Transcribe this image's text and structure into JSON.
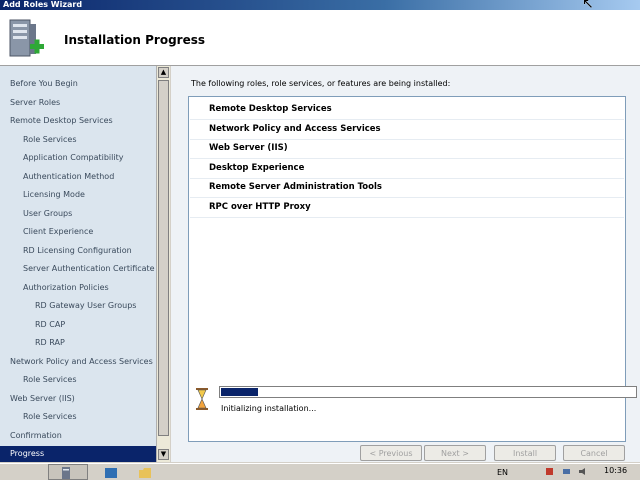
{
  "window": {
    "title": "Add Roles Wizard"
  },
  "header": {
    "title": "Installation Progress",
    "icon": "server-add-icon"
  },
  "nav": {
    "items": [
      {
        "label": "Before You Begin",
        "level": 0
      },
      {
        "label": "Server Roles",
        "level": 0
      },
      {
        "label": "Remote Desktop Services",
        "level": 0
      },
      {
        "label": "Role Services",
        "level": 1
      },
      {
        "label": "Application Compatibility",
        "level": 1
      },
      {
        "label": "Authentication Method",
        "level": 1
      },
      {
        "label": "Licensing Mode",
        "level": 1
      },
      {
        "label": "User Groups",
        "level": 1
      },
      {
        "label": "Client Experience",
        "level": 1
      },
      {
        "label": "RD Licensing Configuration",
        "level": 1
      },
      {
        "label": "Server Authentication Certificate",
        "level": 1
      },
      {
        "label": "Authorization Policies",
        "level": 1
      },
      {
        "label": "RD Gateway User Groups",
        "level": 2
      },
      {
        "label": "RD CAP",
        "level": 2
      },
      {
        "label": "RD RAP",
        "level": 2
      },
      {
        "label": "Network Policy and Access Services",
        "level": 0
      },
      {
        "label": "Role Services",
        "level": 1
      },
      {
        "label": "Web Server (IIS)",
        "level": 0
      },
      {
        "label": "Role Services",
        "level": 1
      },
      {
        "label": "Confirmation",
        "level": 0
      },
      {
        "label": "Progress",
        "level": 0,
        "active": true
      }
    ]
  },
  "content": {
    "intro": "The following roles, role services, or features are being installed:",
    "items": [
      "Remote Desktop Services",
      "Network Policy and Access Services",
      "Web Server (IIS)",
      "Desktop Experience",
      "Remote Server Administration Tools",
      "RPC over HTTP Proxy"
    ],
    "progress_fraction": 0.09,
    "status": "Initializing installation..."
  },
  "buttons": {
    "previous": "< Previous",
    "next": "Next >",
    "install": "Install",
    "cancel": "Cancel"
  },
  "taskbar": {
    "lang": "EN",
    "clock": "10:36"
  },
  "colors": {
    "accent": "#0a246a",
    "nav_bg": "#dbe5ee",
    "content_bg": "#eef2f6"
  }
}
